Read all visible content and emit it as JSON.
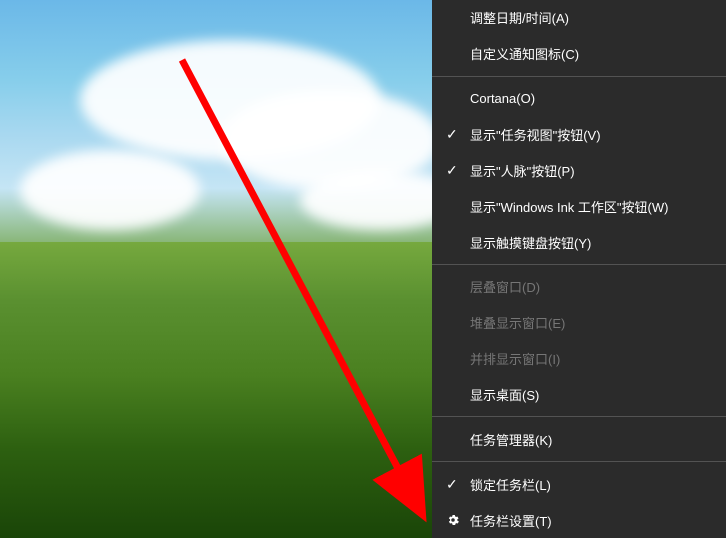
{
  "menu": {
    "groups": [
      {
        "items": [
          {
            "label": "调整日期/时间(A)",
            "checked": false,
            "icon": null,
            "disabled": false
          },
          {
            "label": "自定义通知图标(C)",
            "checked": false,
            "icon": null,
            "disabled": false
          }
        ]
      },
      {
        "items": [
          {
            "label": "Cortana(O)",
            "checked": false,
            "icon": null,
            "disabled": false
          },
          {
            "label": "显示\"任务视图\"按钮(V)",
            "checked": true,
            "icon": null,
            "disabled": false
          },
          {
            "label": "显示\"人脉\"按钮(P)",
            "checked": true,
            "icon": null,
            "disabled": false
          },
          {
            "label": "显示\"Windows Ink 工作区\"按钮(W)",
            "checked": false,
            "icon": null,
            "disabled": false
          },
          {
            "label": "显示触摸键盘按钮(Y)",
            "checked": false,
            "icon": null,
            "disabled": false
          }
        ]
      },
      {
        "items": [
          {
            "label": "层叠窗口(D)",
            "checked": false,
            "icon": null,
            "disabled": true
          },
          {
            "label": "堆叠显示窗口(E)",
            "checked": false,
            "icon": null,
            "disabled": true
          },
          {
            "label": "并排显示窗口(I)",
            "checked": false,
            "icon": null,
            "disabled": true
          },
          {
            "label": "显示桌面(S)",
            "checked": false,
            "icon": null,
            "disabled": false
          }
        ]
      },
      {
        "items": [
          {
            "label": "任务管理器(K)",
            "checked": false,
            "icon": null,
            "disabled": false
          }
        ]
      },
      {
        "items": [
          {
            "label": "锁定任务栏(L)",
            "checked": true,
            "icon": null,
            "disabled": false
          },
          {
            "label": "任务栏设置(T)",
            "checked": false,
            "icon": "gear",
            "disabled": false
          }
        ]
      }
    ]
  },
  "annotation": {
    "arrow_color": "#ff0000"
  }
}
